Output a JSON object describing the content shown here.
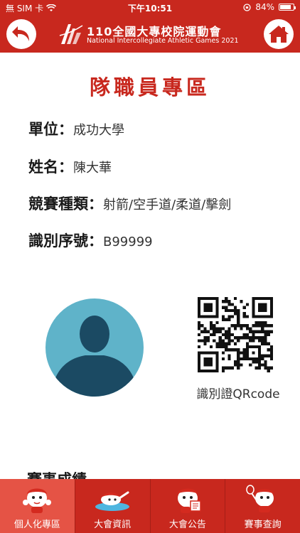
{
  "status_bar": {
    "carrier": "無 SIM 卡",
    "time": "下午10:51",
    "battery_text": "84%",
    "battery_level": 0.84
  },
  "header": {
    "logo_title": "110全國大專校院運動會",
    "logo_subtitle": "National Intercollegiate Athletic Games 2021"
  },
  "page": {
    "title": "隊職員專區",
    "fields": [
      {
        "label": "單位：",
        "value": "成功大學"
      },
      {
        "label": "姓名：",
        "value": "陳大華"
      },
      {
        "label": "競賽種類：",
        "value": "射箭/空手道/柔道/擊劍"
      },
      {
        "label": "識別序號：",
        "value": "B99999"
      }
    ],
    "qr_caption": "識別證QRcode",
    "next_section": "賽事成績"
  },
  "tabs": [
    {
      "label": "個人化專區",
      "active": true
    },
    {
      "label": "大會資訊",
      "active": false
    },
    {
      "label": "大會公告",
      "active": false
    },
    {
      "label": "賽事查詢",
      "active": false
    }
  ],
  "colors": {
    "brand_red": "#c8281e",
    "active_tab": "#e55345",
    "avatar_bg": "#5fb3c9",
    "avatar_figure": "#1b4a63"
  },
  "icons": {
    "back": "back-arrow-icon",
    "home": "home-icon",
    "wifi": "wifi-icon"
  }
}
